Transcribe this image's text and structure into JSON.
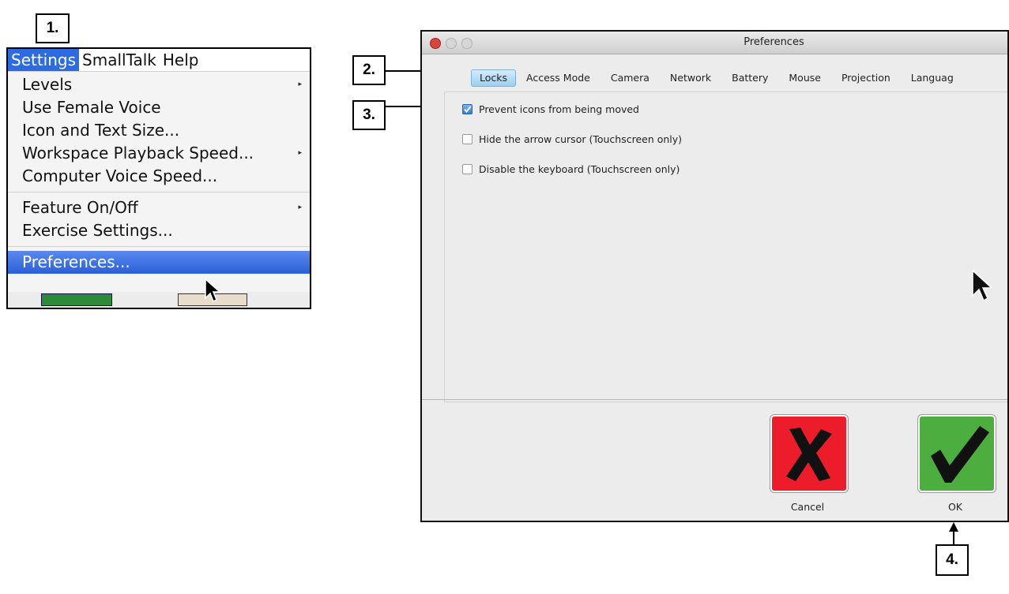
{
  "callouts": {
    "c1": "1.",
    "c2": "2.",
    "c3": "3.",
    "c4": "4."
  },
  "menu": {
    "menubar": [
      "Settings",
      "SmallTalk",
      "Help"
    ],
    "items": [
      "Levels",
      "Use Female Voice",
      "Icon and Text Size...",
      "Workspace Playback Speed...",
      "Computer Voice Speed...",
      "Feature On/Off",
      "Exercise Settings...",
      "Preferences..."
    ]
  },
  "window": {
    "title": "Preferences",
    "tabs": [
      "Locks",
      "Access Mode",
      "Camera",
      "Network",
      "Battery",
      "Mouse",
      "Projection",
      "Languag"
    ],
    "options": [
      {
        "label": "Prevent icons from being moved",
        "checked": true
      },
      {
        "label": "Hide the arrow cursor (Touchscreen only)",
        "checked": false
      },
      {
        "label": "Disable the keyboard (Touchscreen only)",
        "checked": false
      }
    ],
    "cancel_label": "Cancel",
    "ok_label": "OK"
  },
  "colors": {
    "menu_highlight": "#2b60d6",
    "tab_selected": "#9ccff2",
    "cancel_bg": "#ec1c2a",
    "ok_bg": "#4cae3e"
  },
  "icons": [
    "checkbox-checked-icon",
    "cross-icon",
    "checkmark-icon",
    "arrow-cursor-icon",
    "submenu-triangle-icon"
  ]
}
